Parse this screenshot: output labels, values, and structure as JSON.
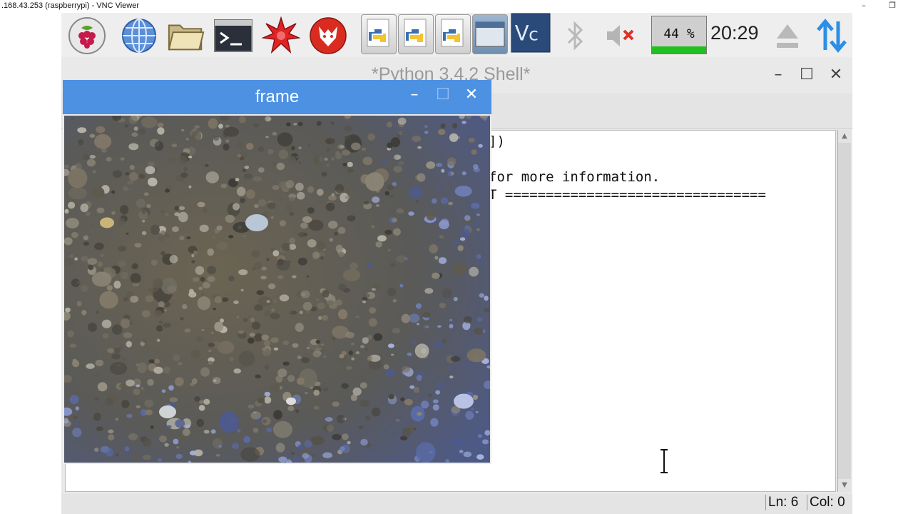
{
  "vnc": {
    "title": ".168.43.253 (raspberrypi) - VNC Viewer",
    "minimize_glyph": "–",
    "restore_glyph": "❐"
  },
  "taskbar": {
    "launchers": [
      {
        "name": "raspberry-menu-icon"
      },
      {
        "name": "web-browser-icon"
      },
      {
        "name": "file-manager-icon"
      },
      {
        "name": "terminal-icon"
      },
      {
        "name": "mathematica-icon"
      },
      {
        "name": "wolfram-icon"
      }
    ],
    "windows": [
      {
        "name": "python-window-button"
      },
      {
        "name": "python-window-button"
      },
      {
        "name": "python-window-button"
      },
      {
        "name": "frame-window-button"
      }
    ],
    "tray": {
      "vnc": "vnc-icon",
      "bluetooth": "bluetooth-icon",
      "volume": "volume-muted-icon",
      "cpu_percent": "44 %",
      "cpu_value": 44,
      "clock": "20:29",
      "eject": "eject-icon",
      "network": "network-icon"
    }
  },
  "shell": {
    "title": "*Python 3.4.2 Shell*",
    "lines": [
      {
        "text": "])"
      },
      {
        "text": "for more information."
      },
      {
        "text": "T ================================"
      }
    ],
    "status": {
      "line": "Ln: 6",
      "col": "Col: 0"
    },
    "minimize_glyph": "–",
    "maximize_glyph": "☐",
    "close_glyph": "✕"
  },
  "frame": {
    "title": "frame",
    "minimize_glyph": "–",
    "maximize_glyph": "☐",
    "close_glyph": "✕"
  },
  "colors": {
    "frame_titlebar": "#4d91e3",
    "cpu_fill": "#20c020",
    "close_red": "#e0302a"
  }
}
